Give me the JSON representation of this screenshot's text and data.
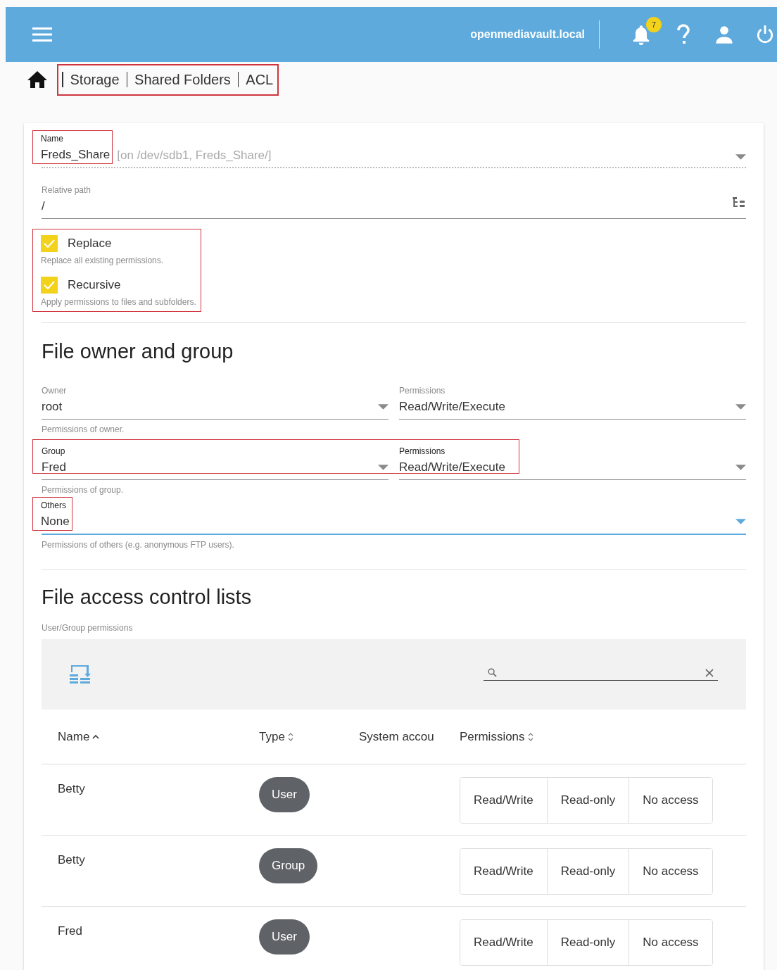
{
  "header": {
    "hostname": "openmediavault.local",
    "notification_count": "7"
  },
  "breadcrumb": {
    "highlighted": true,
    "items": [
      "Storage",
      "Shared Folders",
      "ACL"
    ]
  },
  "form": {
    "name": {
      "label": "Name",
      "value": "Freds_Share",
      "hint": "[on /dev/sdb1, Freds_Share/]",
      "readonly": true,
      "highlighted": true
    },
    "relative_path": {
      "label": "Relative path",
      "value": "/"
    },
    "options": {
      "highlighted": true,
      "items": [
        {
          "label": "Replace",
          "description": "Replace all existing permissions.",
          "checked": true
        },
        {
          "label": "Recursive",
          "description": "Apply permissions to files and subfolders.",
          "checked": true
        }
      ]
    }
  },
  "owner_section": {
    "title": "File owner and group",
    "rows": [
      {
        "highlighted": false,
        "who": {
          "label": "Owner",
          "value": "root"
        },
        "permissions": {
          "label": "Permissions",
          "value": "Read/Write/Execute"
        },
        "help": "Permissions of owner."
      },
      {
        "highlighted": true,
        "who": {
          "label": "Group",
          "value": "Fred"
        },
        "permissions": {
          "label": "Permissions",
          "value": "Read/Write/Execute"
        },
        "help": "Permissions of group."
      }
    ],
    "others": {
      "label": "Others",
      "value": "None",
      "focused": true,
      "highlighted": true,
      "help": "Permissions of others (e.g. anonymous FTP users)."
    }
  },
  "acl_section": {
    "title": "File access control lists",
    "subtitle": "User/Group permissions",
    "columns": [
      {
        "label": "Name",
        "sortable": true,
        "sorted": true
      },
      {
        "label": "Type",
        "sortable": true,
        "sorted": false
      },
      {
        "label": "System accou",
        "sortable": false,
        "sorted": false
      },
      {
        "label": "Permissions",
        "sortable": true,
        "sorted": false
      }
    ],
    "rows": [
      {
        "name": "Betty",
        "type": "User",
        "permissions": [
          {
            "label": "Read/Write",
            "selected": false
          },
          {
            "label": "Read-only",
            "selected": false
          },
          {
            "label": "No access",
            "selected": false
          }
        ]
      },
      {
        "name": "Betty",
        "type": "Group",
        "permissions": [
          {
            "label": "Read/Write",
            "selected": false
          },
          {
            "label": "Read-only",
            "selected": false
          },
          {
            "label": "No access",
            "selected": false
          }
        ]
      },
      {
        "name": "Fred",
        "type": "User",
        "permissions": [
          {
            "label": "Read/Write",
            "selected": false
          },
          {
            "label": "Read-only",
            "selected": false
          },
          {
            "label": "No access",
            "selected": false
          }
        ]
      }
    ]
  }
}
